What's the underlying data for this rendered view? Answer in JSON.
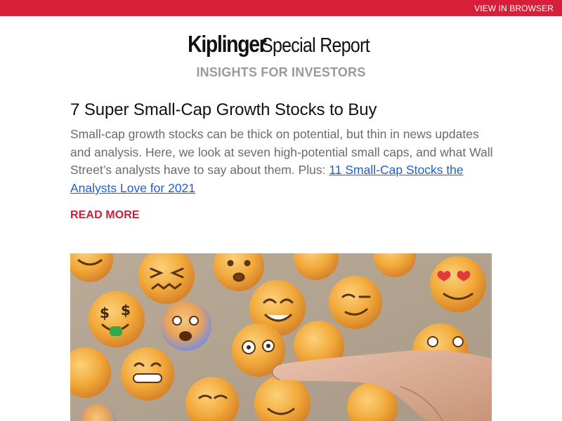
{
  "header": {
    "view_in_browser": "VIEW IN BROWSER",
    "brand_name": "Kiplinger",
    "brand_suffix": "Special Report",
    "tagline": "INSIGHTS FOR INVESTORS"
  },
  "article": {
    "title": "7 Super Small-Cap Growth Stocks to Buy",
    "summary": "Small-cap growth stocks can be thick on potential, but thin in news updates and analysis. Here, we look at seven high-potential small caps, and what Wall Street’s analysts have to say about them. Plus: ",
    "related_link": "11 Small-Cap Stocks the Analysts Love for 2021",
    "read_more": "READ MORE",
    "image_icon": "emoji-faces-hand-image"
  },
  "colors": {
    "top_bar": "#d71f3a",
    "read_more": "#c8203a",
    "link": "#1f5fd0",
    "tagline": "#9a9a9a",
    "body_text": "#6b6b6b"
  }
}
